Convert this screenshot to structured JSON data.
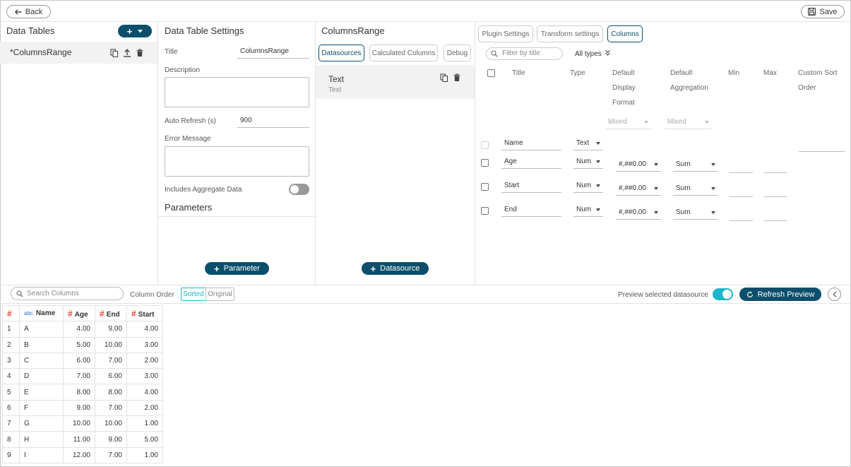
{
  "topbar": {
    "back_label": "Back",
    "save_label": "Save"
  },
  "data_tables": {
    "title": "Data Tables",
    "items": [
      {
        "label": "*ColumnsRange"
      }
    ]
  },
  "settings": {
    "title": "Data Table Settings",
    "title_label": "Title",
    "title_value": "ColumnsRange",
    "description_label": "Description",
    "auto_refresh_label": "Auto Refresh (s)",
    "auto_refresh_value": "900",
    "error_label": "Error Message",
    "aggregate_label": "Includes Aggregate Data",
    "aggregate_enabled": false,
    "parameters_title": "Parameters",
    "parameter_btn": "Parameter"
  },
  "datasource_panel": {
    "title": "ColumnsRange",
    "tabs": [
      {
        "label": "Datasources",
        "active": true
      },
      {
        "label": "Calculated Columns",
        "active": false
      },
      {
        "label": "Debug",
        "active": false
      }
    ],
    "item_title": "Text",
    "item_sub": "Text",
    "datasource_btn": "Datasource"
  },
  "columns_panel": {
    "tabs": [
      {
        "label": "Plugin Settings",
        "active": false
      },
      {
        "label": "Transform settings",
        "active": false
      },
      {
        "label": "Columns",
        "active": true
      }
    ],
    "filter_placeholder": "Filter by title",
    "all_types": "All types",
    "headers": {
      "title": "Title",
      "type": "Type",
      "fmt1": "Default",
      "fmt2": "Display",
      "fmt3": "Format",
      "agg1": "Default",
      "agg2": "Aggregation",
      "min": "Min",
      "max": "Max",
      "sort1": "Custom Sort",
      "sort2": "Order"
    },
    "mixed_format": "Mixed",
    "mixed_agg": "Mixed",
    "rows": [
      {
        "name": "Name",
        "type": "Text",
        "format": "",
        "agg": ""
      },
      {
        "name": "Age",
        "type": "Num",
        "format": "#,##0.00",
        "agg": "Sum"
      },
      {
        "name": "Start",
        "type": "Num",
        "format": "#,##0.00",
        "agg": "Sum"
      },
      {
        "name": "End",
        "type": "Num",
        "format": "#,##0.00",
        "agg": "Sum"
      }
    ]
  },
  "preview": {
    "search_placeholder": "Search Columns",
    "column_order_label": "Column Order",
    "sorted_label": "Sorted",
    "original_label": "Original",
    "preview_selected_label": "Preview selected datasource",
    "preview_selected_enabled": true,
    "refresh_label": "Refresh Preview",
    "headers": {
      "index": "#",
      "name": "Name",
      "age": "Age",
      "end": "End",
      "start": "Start",
      "abc": "abc"
    },
    "rows": [
      {
        "i": "1",
        "name": "A",
        "age": "4.00",
        "end": "9.00",
        "start": "4.00"
      },
      {
        "i": "2",
        "name": "B",
        "age": "5.00",
        "end": "10.00",
        "start": "3.00"
      },
      {
        "i": "3",
        "name": "C",
        "age": "6.00",
        "end": "7.00",
        "start": "2.00"
      },
      {
        "i": "4",
        "name": "D",
        "age": "7.00",
        "end": "6.00",
        "start": "3.00"
      },
      {
        "i": "5",
        "name": "E",
        "age": "8.00",
        "end": "8.00",
        "start": "4.00"
      },
      {
        "i": "6",
        "name": "F",
        "age": "9.00",
        "end": "7.00",
        "start": "2.00"
      },
      {
        "i": "7",
        "name": "G",
        "age": "10.00",
        "end": "10.00",
        "start": "1.00"
      },
      {
        "i": "8",
        "name": "H",
        "age": "11.00",
        "end": "9.00",
        "start": "5.00"
      },
      {
        "i": "9",
        "name": "I",
        "age": "12.00",
        "end": "7.00",
        "start": "1.00"
      }
    ]
  },
  "colors": {
    "accent": "#0b4f6c",
    "toggle_on": "#1fb6c9",
    "numeric_marker": "#e2442f"
  }
}
